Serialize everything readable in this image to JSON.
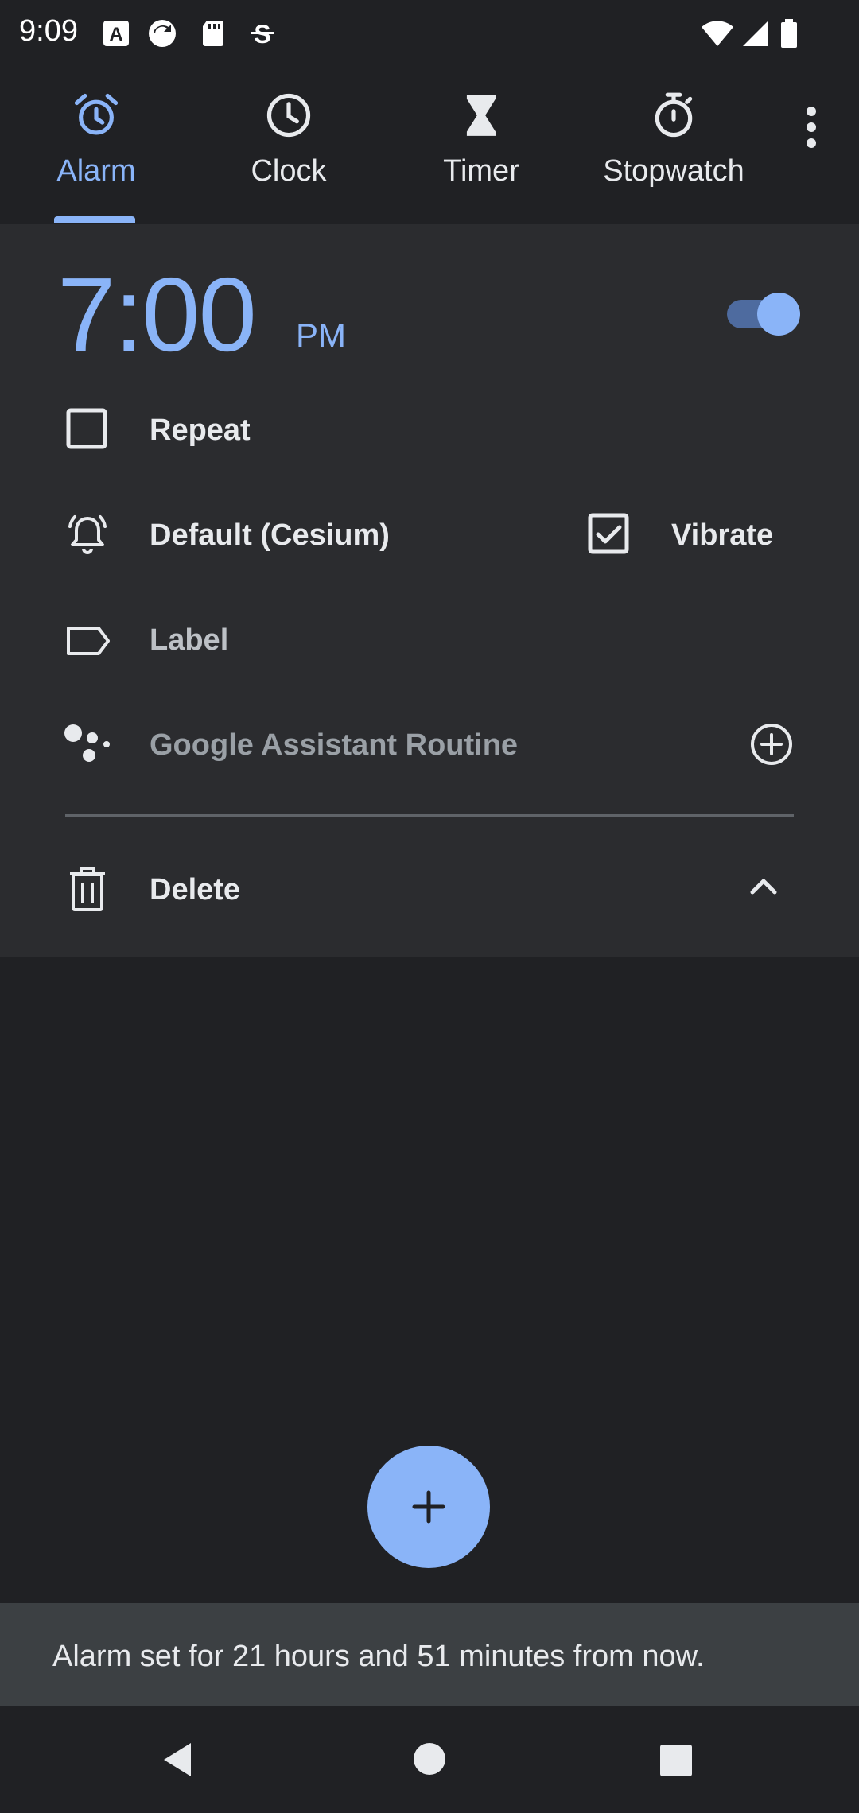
{
  "status_bar": {
    "time": "9:09"
  },
  "tabs": [
    {
      "label": "Alarm",
      "icon": "alarm-icon"
    },
    {
      "label": "Clock",
      "icon": "clock-icon"
    },
    {
      "label": "Timer",
      "icon": "hourglass-icon"
    },
    {
      "label": "Stopwatch",
      "icon": "stopwatch-icon"
    }
  ],
  "alarm": {
    "time": "7:00",
    "ampm": "PM",
    "enabled": true,
    "repeat_label": "Repeat",
    "repeat_checked": false,
    "ringtone_label": "Default (Cesium)",
    "vibrate_label": "Vibrate",
    "vibrate_checked": true,
    "label_placeholder": "Label",
    "routine_label": "Google Assistant Routine",
    "delete_label": "Delete"
  },
  "snackbar": {
    "text": "Alarm set for 21 hours and 51 minutes from now."
  },
  "colors": {
    "accent": "#8ab4f8",
    "background": "#202124",
    "card": "#2b2c2f"
  }
}
